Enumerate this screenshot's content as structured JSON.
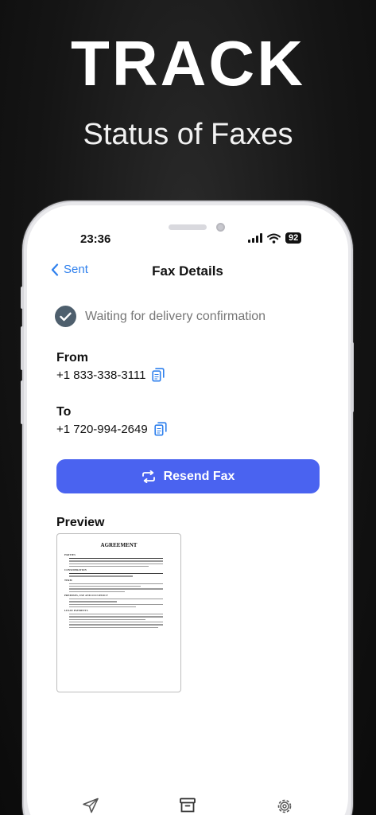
{
  "promo": {
    "headline": "TRACK",
    "subline": "Status of Faxes"
  },
  "status_bar": {
    "time": "23:36",
    "battery": "92"
  },
  "nav": {
    "back_label": "Sent",
    "title": "Fax Details"
  },
  "delivery_status": {
    "text": "Waiting for delivery confirmation"
  },
  "from": {
    "label": "From",
    "number": "+1 833-338-3111"
  },
  "to": {
    "label": "To",
    "number": "+1 720-994-2649"
  },
  "resend": {
    "label": "Resend Fax"
  },
  "preview": {
    "label": "Preview",
    "document_title": "AGREEMENT",
    "sections": [
      "PARTIES",
      "CONSIDERATION",
      "TERM",
      "PREMISES, USE AND OCCUPANCY",
      "LEASE PAYMENTS"
    ]
  },
  "colors": {
    "accent": "#4a63f0",
    "link": "#2f80ed",
    "status_icon": "#4e5f6d"
  },
  "tab_bar": {
    "icons": [
      "send-icon",
      "archive-icon",
      "gear-icon"
    ]
  }
}
